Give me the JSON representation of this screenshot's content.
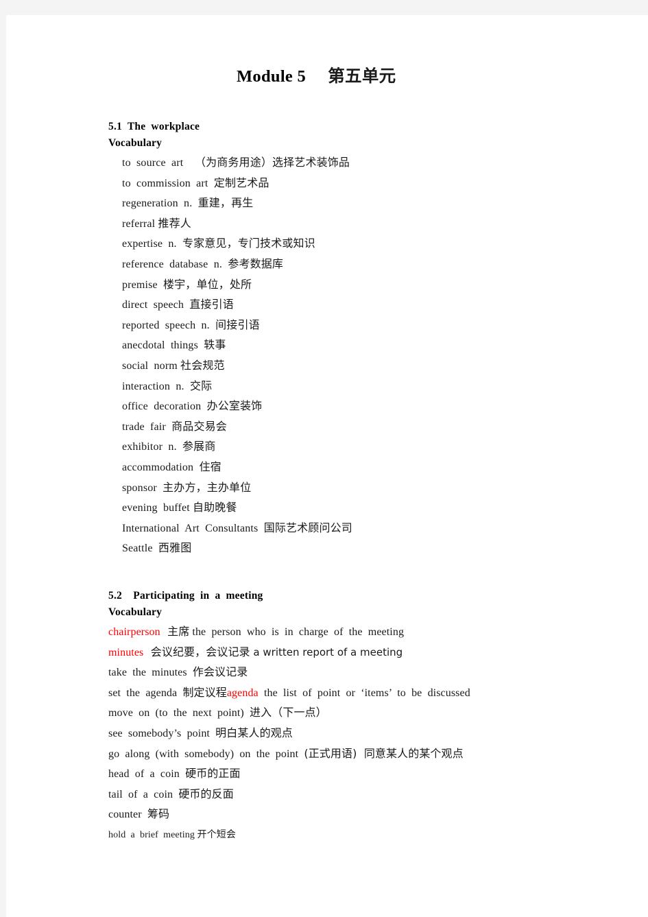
{
  "document": {
    "title_en": "Module 5",
    "title_cn": "第五单元",
    "title_gap": "     "
  },
  "sections": [
    {
      "heading": "5.1  The  workplace",
      "subheading": "Vocabulary",
      "entries": [
        {
          "en": "to  source  art    ",
          "cn": "（为商务用途）选择艺术装饰品"
        },
        {
          "en": "to  commission  art  ",
          "cn": "定制艺术品"
        },
        {
          "en": "regeneration  n.  ",
          "cn": "重建，再生"
        },
        {
          "en": "referral ",
          "cn": "推荐人"
        },
        {
          "en": "expertise  n.  ",
          "cn": "专家意见，专门技术或知识"
        },
        {
          "en": "reference  database  n.  ",
          "cn": "参考数据库"
        },
        {
          "en": "premise  ",
          "cn": "楼宇，单位，处所"
        },
        {
          "en": "direct  speech  ",
          "cn": "直接引语"
        },
        {
          "en": "reported  speech  n.  ",
          "cn": "间接引语"
        },
        {
          "en": "anecdotal  things  ",
          "cn": "轶事"
        },
        {
          "en": "social  norm ",
          "cn": "社会规范"
        },
        {
          "en": "interaction  n.  ",
          "cn": "交际"
        },
        {
          "en": "office  decoration  ",
          "cn": "办公室装饰"
        },
        {
          "en": "trade  fair  ",
          "cn": "商品交易会"
        },
        {
          "en": "exhibitor  n.  ",
          "cn": "参展商"
        },
        {
          "en": "accommodation  ",
          "cn": "住宿"
        },
        {
          "en": "sponsor  ",
          "cn": "主办方，主办单位"
        },
        {
          "en": "evening  buffet ",
          "cn": "自助晚餐"
        },
        {
          "en": "International  Art  Consultants  ",
          "cn": "国际艺术顾问公司"
        },
        {
          "en": "Seattle  ",
          "cn": "西雅图"
        }
      ]
    },
    {
      "heading": "5.2    Participating  in  a  meeting",
      "subheading": "Vocabulary",
      "entries": [
        {
          "term_red": "chairperson",
          "cn": "  主席",
          "def": " the  person  who  is  in  charge  of  the  meeting"
        },
        {
          "term_red": "minutes",
          "cn": "  会议纪要，会议记录",
          "def_sans": " a written report of a meeting"
        },
        {
          "en": "take  the  minutes  ",
          "cn": "作会议记录"
        },
        {
          "en": "set  the  agenda  ",
          "cn": "制定议程",
          "term_red2": "agenda",
          "def2": "  the  list  of  point  or  ‘items’  to  be  discussed"
        },
        {
          "en": "move  on  (to  the  next  point)  ",
          "cn": "进入（下一点）"
        },
        {
          "en": "see  somebody’s  point  ",
          "cn": "明白某人的观点"
        },
        {
          "en": "go  along  (with  somebody)  on  the  point  ",
          "cn": "(正式用语)  同意某人的某个观点"
        },
        {
          "en": "head  of  a  coin  ",
          "cn": "硬币的正面"
        },
        {
          "en": "tail  of  a  coin  ",
          "cn": "硬币的反面"
        },
        {
          "en": "counter  ",
          "cn": "筹码"
        },
        {
          "en": "hold  a  brief  meeting ",
          "cn": "开个短会",
          "small": true
        }
      ]
    }
  ]
}
